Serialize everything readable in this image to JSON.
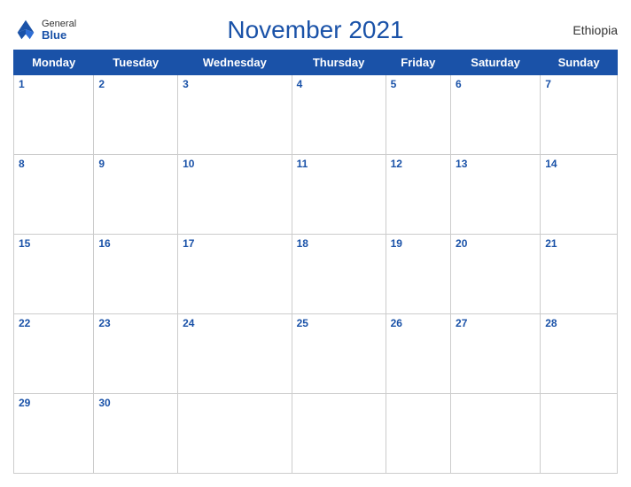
{
  "header": {
    "title": "November 2021",
    "country": "Ethiopia",
    "logo": {
      "general": "General",
      "blue": "Blue"
    }
  },
  "weekdays": [
    "Monday",
    "Tuesday",
    "Wednesday",
    "Thursday",
    "Friday",
    "Saturday",
    "Sunday"
  ],
  "weeks": [
    [
      1,
      2,
      3,
      4,
      5,
      6,
      7
    ],
    [
      8,
      9,
      10,
      11,
      12,
      13,
      14
    ],
    [
      15,
      16,
      17,
      18,
      19,
      20,
      21
    ],
    [
      22,
      23,
      24,
      25,
      26,
      27,
      28
    ],
    [
      29,
      30,
      null,
      null,
      null,
      null,
      null
    ]
  ]
}
